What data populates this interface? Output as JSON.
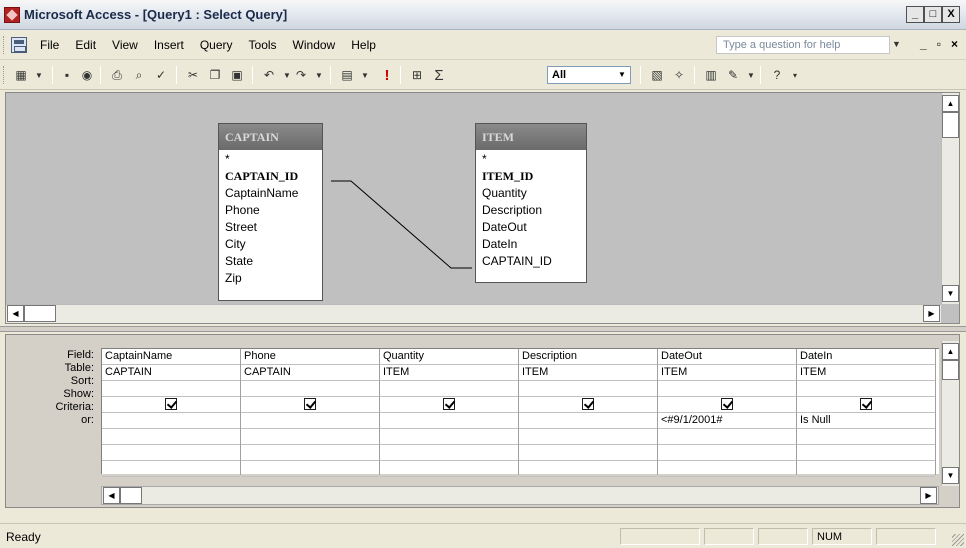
{
  "window": {
    "title": "Microsoft Access - [Query1 : Select Query]",
    "minimize": "_",
    "maximize": "□",
    "close": "X"
  },
  "menu": {
    "items": [
      {
        "label": "File"
      },
      {
        "label": "Edit"
      },
      {
        "label": "View"
      },
      {
        "label": "Insert"
      },
      {
        "label": "Query"
      },
      {
        "label": "Tools"
      },
      {
        "label": "Window"
      },
      {
        "label": "Help"
      }
    ],
    "help_placeholder": "Type a question for help",
    "doc_controls": [
      "_",
      "▫",
      "×"
    ]
  },
  "toolbar": {
    "top_values": "All",
    "icons": [
      "view-icon",
      "save-icon",
      "search-icon",
      "print-icon",
      "print-preview-icon",
      "spelling-icon",
      "cut-icon",
      "copy-icon",
      "paste-icon",
      "undo-icon",
      "redo-icon",
      "query-type-icon",
      "run-icon",
      "show-table-icon",
      "totals-icon",
      "properties-icon",
      "build-icon",
      "database-window-icon",
      "new-object-icon",
      "help-icon"
    ]
  },
  "design": {
    "tables": [
      {
        "name": "CAPTAIN",
        "fields": [
          "*",
          "CAPTAIN_ID",
          "CaptainName",
          "Phone",
          "Street",
          "City",
          "State",
          "Zip"
        ],
        "key": "CAPTAIN_ID"
      },
      {
        "name": "ITEM",
        "fields": [
          "*",
          "ITEM_ID",
          "Quantity",
          "Description",
          "DateOut",
          "DateIn",
          "CAPTAIN_ID"
        ],
        "key": "ITEM_ID"
      }
    ]
  },
  "grid": {
    "row_labels": [
      "Field:",
      "Table:",
      "Sort:",
      "Show:",
      "Criteria:",
      "or:"
    ],
    "columns": [
      {
        "field": "CaptainName",
        "table": "CAPTAIN",
        "sort": "",
        "show": true,
        "criteria": "",
        "or": ""
      },
      {
        "field": "Phone",
        "table": "CAPTAIN",
        "sort": "",
        "show": true,
        "criteria": "",
        "or": ""
      },
      {
        "field": "Quantity",
        "table": "ITEM",
        "sort": "",
        "show": true,
        "criteria": "",
        "or": ""
      },
      {
        "field": "Description",
        "table": "ITEM",
        "sort": "",
        "show": true,
        "criteria": "",
        "or": ""
      },
      {
        "field": "DateOut",
        "table": "ITEM",
        "sort": "",
        "show": true,
        "criteria": "<#9/1/2001#",
        "or": ""
      },
      {
        "field": "DateIn",
        "table": "ITEM",
        "sort": "",
        "show": true,
        "criteria": "Is Null",
        "or": ""
      }
    ]
  },
  "status": {
    "text": "Ready",
    "num": "NUM"
  }
}
